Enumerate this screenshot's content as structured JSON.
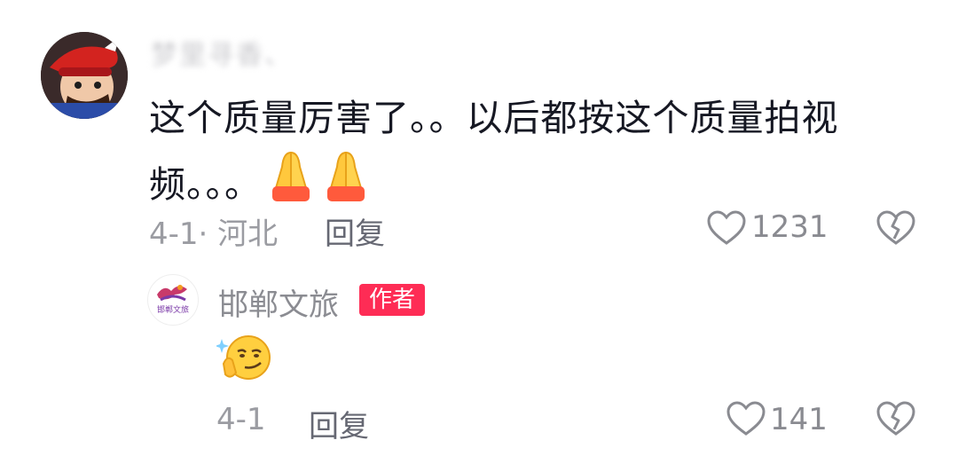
{
  "main_comment": {
    "username": "梦里寻香、",
    "text": "这个质量厉害了。。以后都按这个质量拍视频。。。",
    "emoji": "folded-hands-emoji",
    "meta": "4-1· 河北",
    "reply_label": "回复",
    "like_count": "1231"
  },
  "reply_comment": {
    "username": "邯郸文旅",
    "badge": "作者",
    "avatar_text": "邯郸文旅",
    "emoji": "thinking-smirk-emoji",
    "meta": "4-1",
    "reply_label": "回复",
    "like_count": "141"
  },
  "colors": {
    "badge": "#fe2c55",
    "meta": "#9b9ca2",
    "text": "#161823"
  }
}
